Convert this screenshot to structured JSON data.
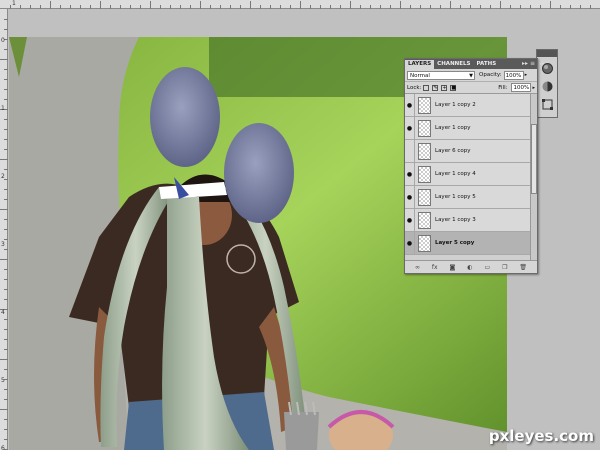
{
  "ruler": {
    "top_numbers": [
      "1"
    ],
    "left_numbers": [
      "0",
      "1",
      "2",
      "3",
      "4",
      "5",
      "6"
    ]
  },
  "layers_panel": {
    "tabs": [
      "LAYERS",
      "CHANNELS",
      "PATHS"
    ],
    "menu_glyph": "▸▸ ≡",
    "blend_mode": "Normal",
    "opacity_label": "Opacity:",
    "opacity_value": "100%",
    "lock_label": "Lock:",
    "fill_label": "Fill:",
    "fill_value": "100%",
    "layers": [
      {
        "name": "Layer 1 copy 2",
        "visible": true,
        "selected": false
      },
      {
        "name": "Layer 1 copy",
        "visible": true,
        "selected": false
      },
      {
        "name": "Layer 6 copy",
        "visible": false,
        "selected": false
      },
      {
        "name": "Layer 1 copy 4",
        "visible": true,
        "selected": false
      },
      {
        "name": "Layer 1 copy 5",
        "visible": true,
        "selected": false
      },
      {
        "name": "Layer 1 copy 3",
        "visible": true,
        "selected": false
      },
      {
        "name": "Layer 5 copy",
        "visible": true,
        "selected": true
      }
    ],
    "footer_icons": [
      "link-icon",
      "fx-icon",
      "mask-icon",
      "adjustment-icon",
      "group-icon",
      "new-layer-icon",
      "trash-icon"
    ]
  },
  "side_tools": {
    "header_glyph": "◂◂ ✕",
    "icons": [
      "styles-icon",
      "adjustments-icon",
      "transform-icon"
    ]
  },
  "watermark": "pxleyes.com",
  "colors": {
    "pasteboard": "#c0c0c0",
    "panel_bg": "#d6d6d6",
    "selected_row": "#b3b3b3"
  }
}
